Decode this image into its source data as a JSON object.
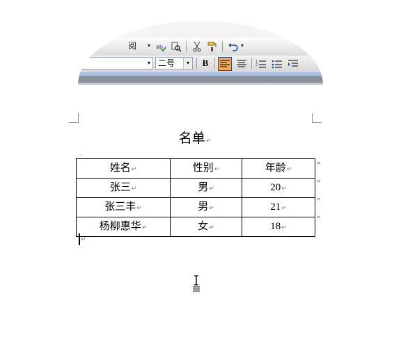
{
  "toolbar": {
    "row1": {
      "truncated_label": "阅",
      "icons": [
        "spellcheck-icon",
        "research-icon",
        "cut-icon",
        "format-painter-icon",
        "undo-icon"
      ]
    },
    "row2": {
      "font_size": "二号",
      "bold_label": "B",
      "icons": [
        "align-left-icon",
        "align-center-icon",
        "numbered-list-icon",
        "bulleted-list-icon",
        "indent-icon"
      ],
      "active_alignment": "align-left"
    }
  },
  "document": {
    "title": "名单",
    "para_mark": "↵",
    "table": {
      "header": [
        "姓名",
        "性别",
        "年龄"
      ],
      "rows": [
        [
          "张三",
          "男",
          "20"
        ],
        [
          "张三丰",
          "男",
          "21"
        ],
        [
          "杨柳惠华",
          "女",
          "18"
        ]
      ]
    }
  },
  "colors": {
    "active_button": "#f6a94f",
    "toolbar_band": "#8b8f99",
    "toolbar_blue": "#a8c0e2"
  }
}
